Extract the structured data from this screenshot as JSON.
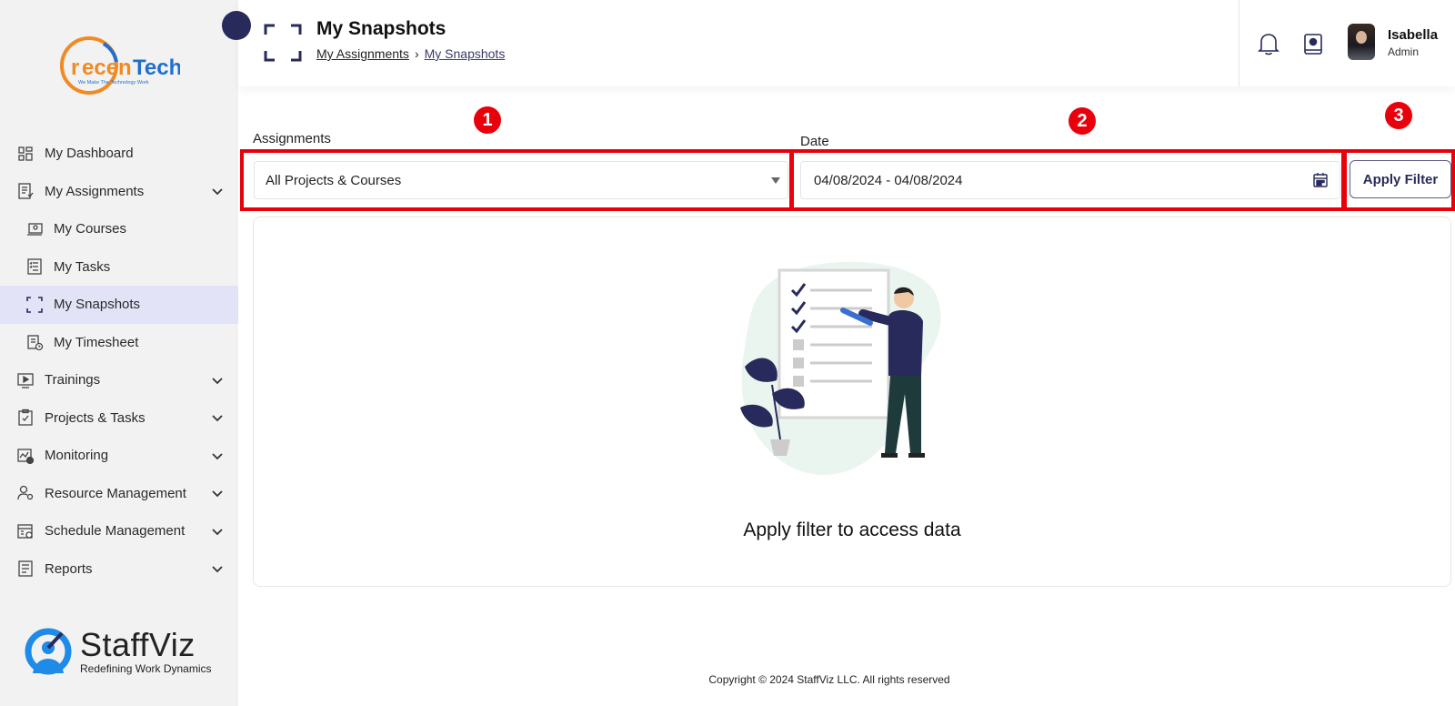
{
  "sidebar": {
    "logo": {
      "text": "recenTech",
      "tagline": "We Make The Technology Work"
    },
    "items": [
      {
        "label": "My Dashboard",
        "icon": "dashboard-icon",
        "chevron": false
      },
      {
        "label": "My Assignments",
        "icon": "assignments-icon",
        "chevron": true
      },
      {
        "label": "My Courses",
        "icon": "courses-icon",
        "chevron": false,
        "sub": true
      },
      {
        "label": "My Tasks",
        "icon": "tasks-icon",
        "chevron": false,
        "sub": true
      },
      {
        "label": "My Snapshots",
        "icon": "snapshot-icon",
        "chevron": false,
        "sub": true,
        "active": true
      },
      {
        "label": "My Timesheet",
        "icon": "timesheet-icon",
        "chevron": false,
        "sub": true
      },
      {
        "label": "Trainings",
        "icon": "play-icon",
        "chevron": true
      },
      {
        "label": "Projects & Tasks",
        "icon": "clipboard-check-icon",
        "chevron": true
      },
      {
        "label": "Monitoring",
        "icon": "monitoring-icon",
        "chevron": true
      },
      {
        "label": "Resource Management",
        "icon": "user-gear-icon",
        "chevron": true
      },
      {
        "label": "Schedule Management",
        "icon": "calendar-gear-icon",
        "chevron": true
      },
      {
        "label": "Reports",
        "icon": "report-icon",
        "chevron": true
      }
    ],
    "brand": {
      "name": "StaffViz",
      "tagline": "Redefining Work Dynamics"
    }
  },
  "header": {
    "title": "My Snapshots",
    "breadcrumb": {
      "parent": "My Assignments",
      "current": "My Snapshots"
    },
    "user": {
      "name": "Isabella",
      "role": "Admin"
    }
  },
  "filters": {
    "assignments_label": "Assignments",
    "assignments_value": "All Projects & Courses",
    "date_label": "Date",
    "date_value": "04/08/2024 - 04/08/2024",
    "apply_label": "Apply Filter",
    "badges": [
      "1",
      "2",
      "3"
    ]
  },
  "main": {
    "empty_message": "Apply filter to access data"
  },
  "footer": {
    "copyright": "Copyright © 2024 StaffViz LLC. All rights reserved"
  },
  "colors": {
    "accent": "#272a5a",
    "highlight": "#e8000a",
    "active_bg": "#e3e3f8",
    "logo_orange": "#f08a24",
    "logo_blue": "#1f6fd1"
  }
}
